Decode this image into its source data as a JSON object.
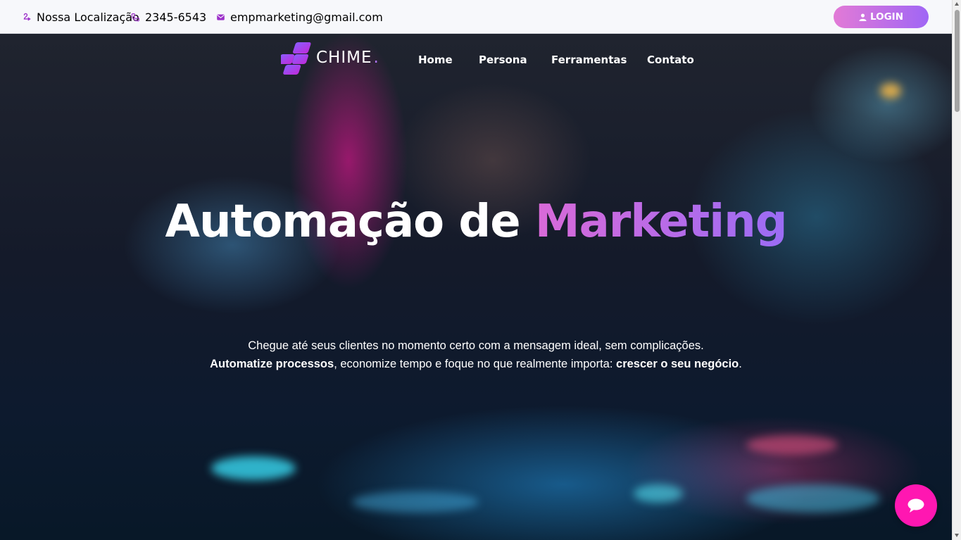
{
  "topbar": {
    "location": "Nossa Localização",
    "phone": "2345-6543",
    "email": "empmarketing@gmail.com",
    "login_label": "LOGIN"
  },
  "nav": {
    "logo_text": "CHIME",
    "logo_dot": ".",
    "links": [
      "Home",
      "Persona",
      "Ferramentas",
      "Contato"
    ]
  },
  "hero": {
    "headline_white": "Automação de ",
    "headline_accent": "Marketing",
    "sub_line1": "Chegue até seus clientes no momento certo com a mensagem ideal, sem complicações.",
    "sub_bold1": "Automatize processos",
    "sub_mid": ", economize tempo e foque no que realmente importa: ",
    "sub_bold2": "crescer o seu negócio",
    "sub_end": "."
  },
  "colors": {
    "accent_start": "#e27ad6",
    "accent_end": "#a066f5",
    "icon_purple": "#9b2fc9",
    "chat_button": "#ff17b1"
  },
  "icons": {
    "location": "location-icon",
    "phone": "phone-icon",
    "email": "email-icon",
    "user": "user-icon",
    "chat": "chat-icon"
  }
}
